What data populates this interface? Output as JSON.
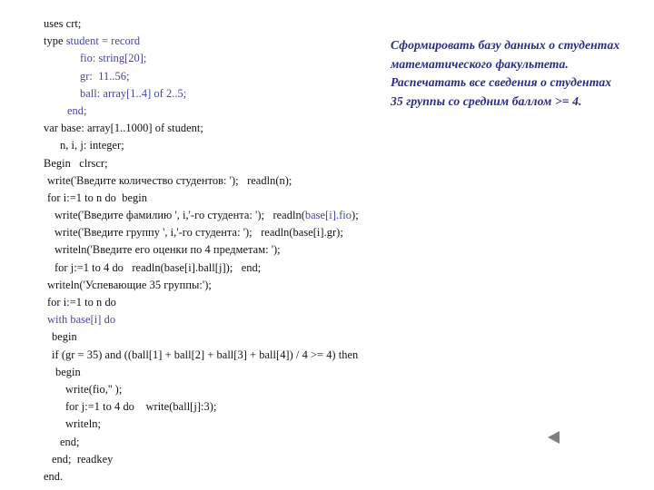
{
  "slide": {
    "background_color": "#ffffff",
    "code_color_plain": "#121212",
    "code_color_keyword": "#4646a0",
    "task_color": "#2b2b86",
    "nav_color": "#808080"
  },
  "code": {
    "language": "Pascal",
    "lines": [
      {
        "indent": 0,
        "segments": [
          {
            "text": "uses crt;",
            "style": "plain"
          }
        ]
      },
      {
        "indent": 0,
        "segments": [
          {
            "text": "type ",
            "style": "plain"
          },
          {
            "text": "student = record",
            "style": "blue"
          }
        ]
      },
      {
        "indent": 40,
        "segments": [
          {
            "text": "fio: string[20];",
            "style": "blue"
          }
        ]
      },
      {
        "indent": 40,
        "segments": [
          {
            "text": "gr:  11..56;",
            "style": "blue"
          }
        ]
      },
      {
        "indent": 40,
        "segments": [
          {
            "text": "ball: array[1..4] of 2..5;",
            "style": "blue"
          }
        ]
      },
      {
        "indent": 26,
        "segments": [
          {
            "text": "end;",
            "style": "blue"
          }
        ]
      },
      {
        "indent": 0,
        "segments": [
          {
            "text": "var base: array[1..1000] of student;",
            "style": "plain"
          }
        ]
      },
      {
        "indent": 18,
        "segments": [
          {
            "text": "n, i, j: integer;",
            "style": "plain"
          }
        ]
      },
      {
        "indent": 0,
        "segments": [
          {
            "text": "Begin   clrscr;",
            "style": "plain"
          }
        ]
      },
      {
        "indent": 4,
        "segments": [
          {
            "text": "write('Введите количество студентов: ');   readln(n);",
            "style": "plain"
          }
        ]
      },
      {
        "indent": 4,
        "segments": [
          {
            "text": "for i:=1 to n do  begin",
            "style": "plain"
          }
        ]
      },
      {
        "indent": 12,
        "segments": [
          {
            "text": "write('Введите фамилию ', i,'-го студента: ');   readln(",
            "style": "plain"
          },
          {
            "text": "base[i].fio",
            "style": "blue"
          },
          {
            "text": ");",
            "style": "plain"
          }
        ]
      },
      {
        "indent": 12,
        "segments": [
          {
            "text": "write('Введите группу ', i,'-го студента: ');   readln(base[i].gr);",
            "style": "plain"
          }
        ]
      },
      {
        "indent": 12,
        "segments": [
          {
            "text": "writeln('Введите его оценки по 4 предметам: ');",
            "style": "plain"
          }
        ]
      },
      {
        "indent": 12,
        "segments": [
          {
            "text": "for j:=1 to 4 do   readln(base[i].ball[j]);   end;",
            "style": "plain"
          }
        ]
      },
      {
        "indent": 4,
        "segments": [
          {
            "text": "writeln('Успевающие 35 группы:');",
            "style": "plain"
          }
        ]
      },
      {
        "indent": 4,
        "segments": [
          {
            "text": "for i:=1 to n do",
            "style": "plain"
          }
        ]
      },
      {
        "indent": 4,
        "segments": [
          {
            "text": "with base[i] do",
            "style": "blue"
          }
        ]
      },
      {
        "indent": 9,
        "segments": [
          {
            "text": "begin",
            "style": "plain"
          }
        ]
      },
      {
        "indent": 9,
        "segments": [
          {
            "text": "if (gr = 35) and ((ball[1] + ball[2] + ball[3] + ball[4]) / 4 >= 4) then",
            "style": "plain"
          }
        ]
      },
      {
        "indent": 13,
        "segments": [
          {
            "text": "begin",
            "style": "plain"
          }
        ]
      },
      {
        "indent": 24,
        "segments": [
          {
            "text": "write(fio,'' );",
            "style": "plain"
          }
        ]
      },
      {
        "indent": 24,
        "segments": [
          {
            "text": "for j:=1 to 4 do    write(ball[j]:3);",
            "style": "plain"
          }
        ]
      },
      {
        "indent": 24,
        "segments": [
          {
            "text": "writeln;",
            "style": "plain"
          }
        ]
      },
      {
        "indent": 18,
        "segments": [
          {
            "text": "end;",
            "style": "plain"
          }
        ]
      },
      {
        "indent": 9,
        "segments": [
          {
            "text": "end;  readkey",
            "style": "plain"
          }
        ]
      },
      {
        "indent": 0,
        "segments": [
          {
            "text": "end.",
            "style": "plain"
          }
        ]
      }
    ]
  },
  "task": {
    "text": "Сформировать базу данных о студентах математического факультета. Распечатать все сведения о студентах 35 группы со средним баллом >= 4."
  },
  "navigation": {
    "back_icon": "triangle-left-icon",
    "back_label": "◀"
  }
}
